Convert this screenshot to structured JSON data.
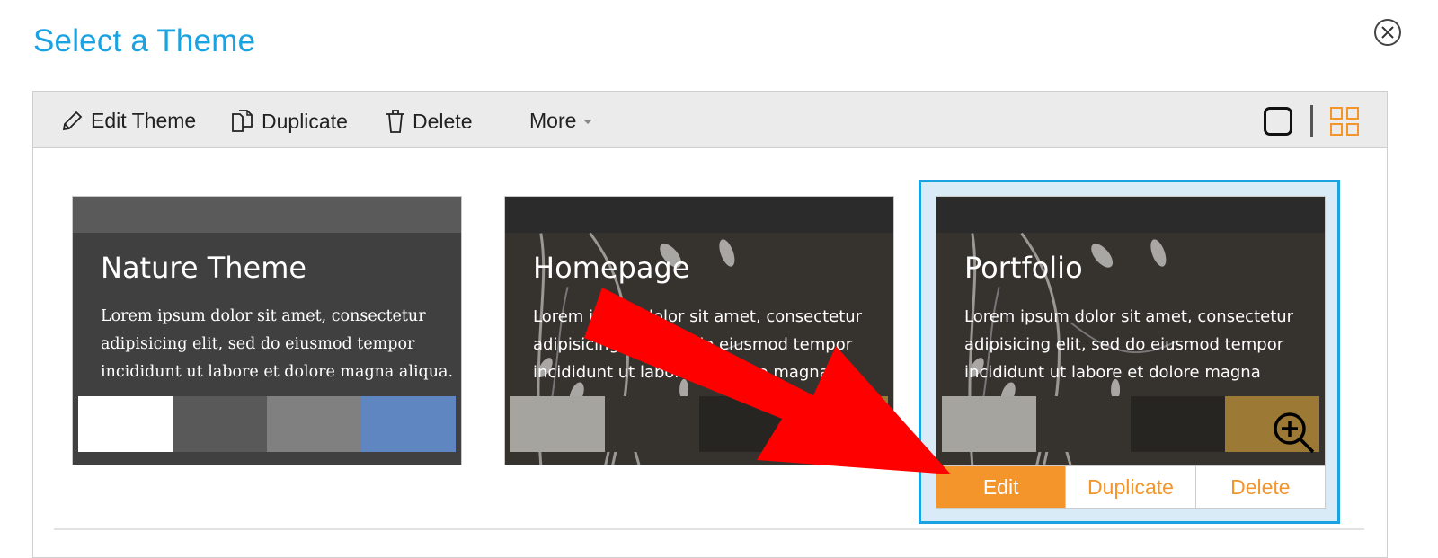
{
  "dialog": {
    "title": "Select a Theme",
    "close_icon": "close-circle-icon"
  },
  "toolbar": {
    "edit_theme": "Edit Theme",
    "duplicate": "Duplicate",
    "delete": "Delete",
    "more": "More",
    "view_single_icon": "single-view-icon",
    "view_grid_icon": "grid-view-icon",
    "active_view": "grid"
  },
  "themes": [
    {
      "name": "Nature Theme",
      "description": "Lorem ipsum dolor sit amet, consectetur adipisicing elit, sed do eiusmod tempor incididunt ut labore et dolore magna aliqua.",
      "colors": {
        "header": "#5a5a5a",
        "body": "#404040"
      },
      "swatches": [
        "#ffffff",
        "#595959",
        "#808080",
        "#5f86c0"
      ],
      "selected": false
    },
    {
      "name": "Homepage",
      "description": "Lorem ipsum dolor sit amet, consectetur adipisicing elit, sed do eiusmod tempor incididunt ut labore et dolore magna",
      "colors": {
        "header": "#2b2b2b",
        "body": "#36332f"
      },
      "swatches": [
        "#a6a49f",
        "#36332f",
        "#272522",
        "#9c7a35"
      ],
      "selected": false
    },
    {
      "name": "Portfolio",
      "description": "Lorem ipsum dolor sit amet, consectetur adipisicing elit, sed do eiusmod tempor incididunt ut labore et dolore magna",
      "colors": {
        "header": "#2b2b2b",
        "body": "#36332f"
      },
      "swatches": [
        "#a6a49f",
        "#36332f",
        "#272522",
        "#9c7a35"
      ],
      "selected": true
    }
  ],
  "card_actions": {
    "edit": "Edit",
    "duplicate": "Duplicate",
    "delete": "Delete"
  },
  "colors": {
    "accent_blue": "#1aa3e0",
    "accent_orange": "#f4952b",
    "annotation_arrow": "#ff0000"
  }
}
